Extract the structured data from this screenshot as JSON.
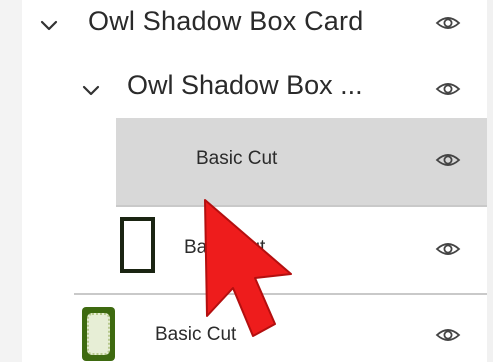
{
  "layers": {
    "items": [
      {
        "label": "Owl Shadow Box Card",
        "icon": "chevron-down-icon",
        "visibility_icon": "eye-icon"
      },
      {
        "label": "Owl Shadow Box ...",
        "icon": "chevron-down-icon",
        "visibility_icon": "eye-icon"
      },
      {
        "label": "Basic Cut",
        "selected": true,
        "visibility_icon": "eye-icon"
      },
      {
        "label": "Basic Cut",
        "thumbnail": "dark-frame-thumbnail",
        "visibility_icon": "eye-icon"
      },
      {
        "label": "Basic Cut",
        "thumbnail": "green-frame-thumbnail",
        "visibility_icon": "eye-icon"
      }
    ]
  },
  "colors": {
    "selected_row": "#d8d8d8",
    "cursor": "#ee1c1c",
    "green_frame": "#3e6a10",
    "dark_frame": "#1a2412"
  }
}
